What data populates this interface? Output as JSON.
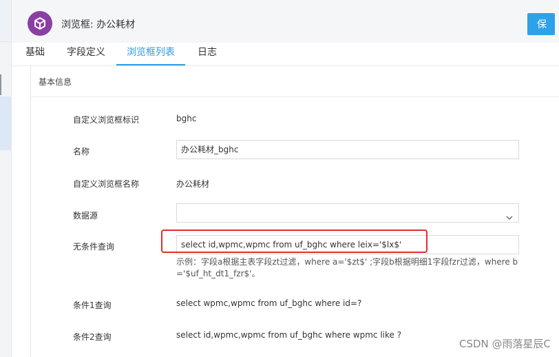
{
  "header": {
    "title": "浏览框: 办公耗材",
    "save_label": "保",
    "icon": "box-icon",
    "icon_color": "#8b3fa2"
  },
  "tabs": [
    {
      "label": "基础",
      "active": false
    },
    {
      "label": "字段定义",
      "active": false
    },
    {
      "label": "浏览框列表",
      "active": true
    },
    {
      "label": "日志",
      "active": false
    }
  ],
  "section": {
    "title": "基本信息"
  },
  "fields": {
    "browser_id": {
      "label": "自定义浏览框标识",
      "value": "bghc"
    },
    "name": {
      "label": "名称",
      "value": "办公耗材_bghc"
    },
    "browser_name": {
      "label": "自定义浏览框名称",
      "value": "办公耗材"
    },
    "datasource": {
      "label": "数据源",
      "value": ""
    },
    "query": {
      "label": "无条件查询",
      "value": "select id,wpmc,wpmc from uf_bghc where leix='$lx$'"
    },
    "hint": "示例：字段a根据主表字段zt过滤，where a='$zt$' ;字段b根据明细1字段fzr过滤，where b ='$uf_ht_dt1_fzr$'。",
    "cond1": {
      "label": "条件1查询",
      "value": "select wpmc,wpmc from uf_bghc where id=?"
    },
    "cond2": {
      "label": "条件2查询",
      "value": "select id,wpmc,wpmc from uf_bghc where wpmc like ?"
    }
  },
  "watermark": "CSDN @雨落星辰C",
  "colors": {
    "accent": "#2d9ae0",
    "highlight": "#e52b2b"
  }
}
